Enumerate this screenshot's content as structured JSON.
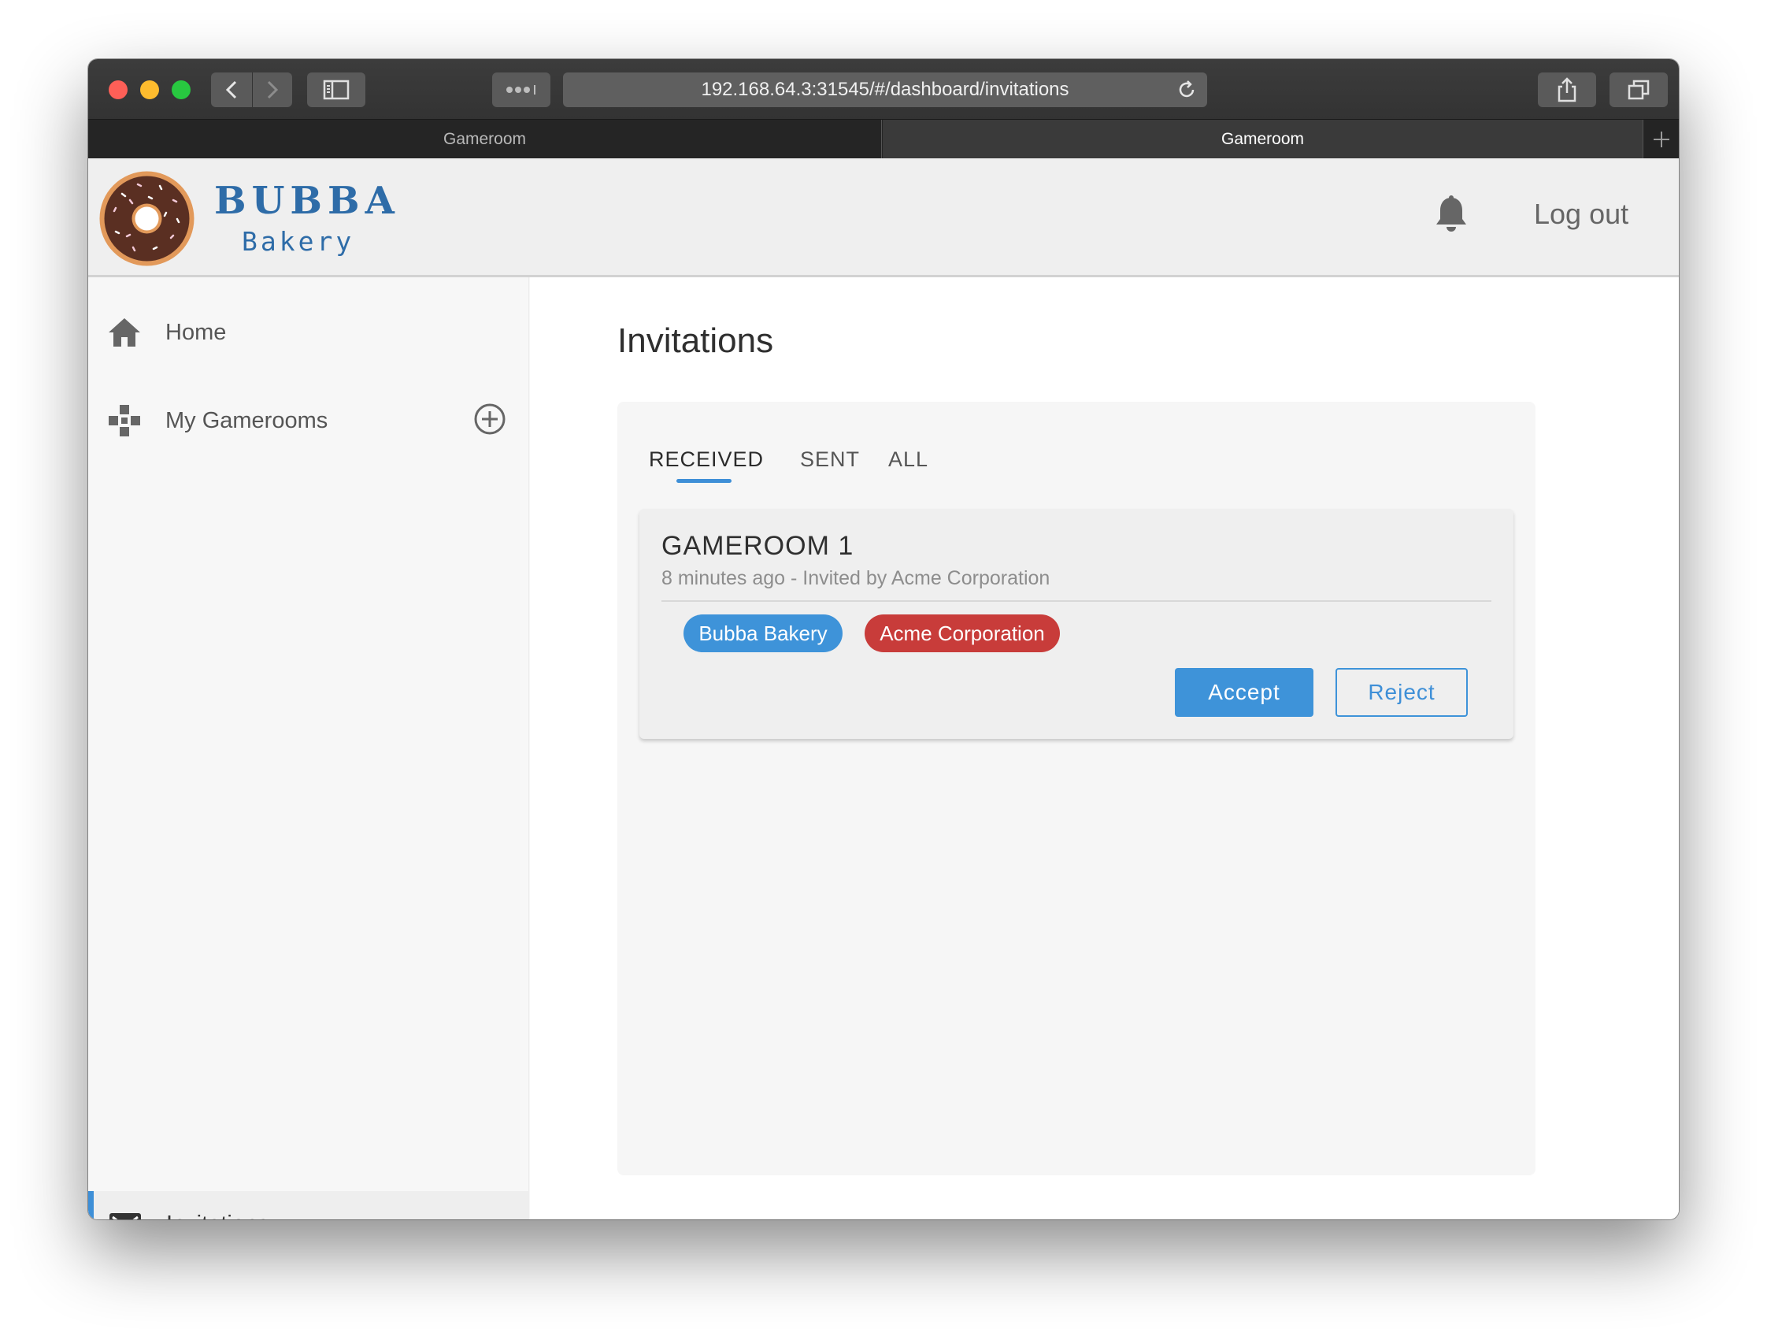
{
  "browser": {
    "url": "192.168.64.3:31545/#/dashboard/invitations",
    "tabs": [
      {
        "label": "Gameroom",
        "active": false
      },
      {
        "label": "Gameroom",
        "active": true
      }
    ]
  },
  "header": {
    "brand_title": "BUBBA",
    "brand_subtitle": "Bakery",
    "logout_label": "Log out"
  },
  "sidebar": {
    "items": [
      {
        "label": "Home",
        "icon": "home-icon"
      },
      {
        "label": "My Gamerooms",
        "icon": "gamepad-icon"
      },
      {
        "label": "Invitations",
        "icon": "envelope-icon",
        "active": true
      }
    ]
  },
  "main": {
    "title": "Invitations",
    "tabs": [
      {
        "label": "RECEIVED",
        "active": true
      },
      {
        "label": "SENT"
      },
      {
        "label": "ALL"
      }
    ],
    "invitation": {
      "title": "GAMEROOM 1",
      "meta": "8 minutes ago - Invited by Acme Corporation",
      "members": [
        {
          "label": "Bubba Bakery",
          "color": "#3e93d9"
        },
        {
          "label": "Acme Corporation",
          "color": "#c83c3a"
        }
      ],
      "accept_label": "Accept",
      "reject_label": "Reject"
    }
  },
  "colors": {
    "accent": "#3e8fd7",
    "brand": "#2e6ca8",
    "danger": "#c83c3a"
  }
}
